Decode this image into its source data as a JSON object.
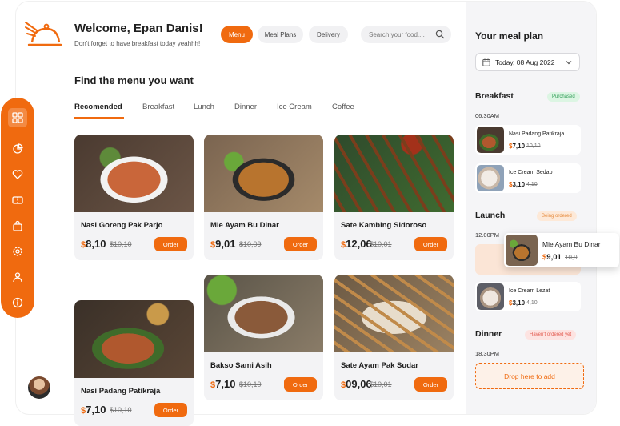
{
  "header": {
    "title": "Welcome, Epan Danis!",
    "subtitle": "Don't forget to have breakfast today yeahhh!",
    "nav": [
      {
        "label": "Menu"
      },
      {
        "label": "Meal Plans"
      },
      {
        "label": "Delivery"
      }
    ],
    "search": {
      "placeholder": "Search your food...."
    }
  },
  "main": {
    "title": "Find the menu you want",
    "tabs": [
      {
        "label": "Recomended"
      },
      {
        "label": "Breakfast"
      },
      {
        "label": "Lunch"
      },
      {
        "label": "Dinner"
      },
      {
        "label": "Ice Cream"
      },
      {
        "label": "Coffee"
      }
    ],
    "currency_symbol": "$",
    "order_label": "Order",
    "cards": [
      {
        "name": "Nasi Goreng Pak Parjo",
        "price": "8,10",
        "old_price": "$10,10"
      },
      {
        "name": "Mie Ayam Bu Dinar",
        "price": "9,01",
        "old_price": "$10,09"
      },
      {
        "name": "Sate Kambing Sidoroso",
        "price": "12,06",
        "old_price": "$10,01"
      },
      {
        "name": "Nasi Padang Patikraja",
        "price": "7,10",
        "old_price": "$10,10"
      },
      {
        "name": "Bakso Sami Asih",
        "price": "7,10",
        "old_price": "$10,10"
      },
      {
        "name": "Sate Ayam Pak Sudar",
        "price": "09,06",
        "old_price": "$10,01"
      }
    ]
  },
  "sidebar": {
    "icons": [
      "grid-icon",
      "pie-chart-icon",
      "heart-icon",
      "ticket-icon",
      "bag-icon",
      "settings-icon",
      "user-icon",
      "info-icon"
    ]
  },
  "plan": {
    "title": "Your meal plan",
    "date": "Today, 08 Aug 2022",
    "breakfast": {
      "title": "Breakfast",
      "status": "Purchased",
      "time": "06.30AM",
      "items": [
        {
          "name": "Nasi Padang Patikraja",
          "price": "7,10",
          "old_price": "10,10"
        },
        {
          "name": "Ice Cream Sedap",
          "price": "3,10",
          "old_price": "4,10"
        }
      ]
    },
    "lunch": {
      "title": "Launch",
      "status": "Being ordered",
      "time": "12.00PM",
      "dragged": {
        "name": "Mie Ayam Bu Dinar",
        "price": "9,01",
        "old_price": "10,9"
      },
      "items": [
        {
          "name": "Ice Cream Lezat",
          "price": "3,10",
          "old_price": "4,10"
        }
      ]
    },
    "dinner": {
      "title": "Dinner",
      "status": "Haven't ordered yet",
      "time": "18.30PM",
      "drop_label": "Drop here to add"
    }
  },
  "colors": {
    "accent": "#f06a0f",
    "purchased_bg": "#dcf5e3",
    "purchased_text": "#2e9b55",
    "ordering_bg": "#fde9d8",
    "ordering_text": "#e58a3c",
    "not_ordered_bg": "#fde3e1",
    "not_ordered_text": "#e35d52"
  }
}
